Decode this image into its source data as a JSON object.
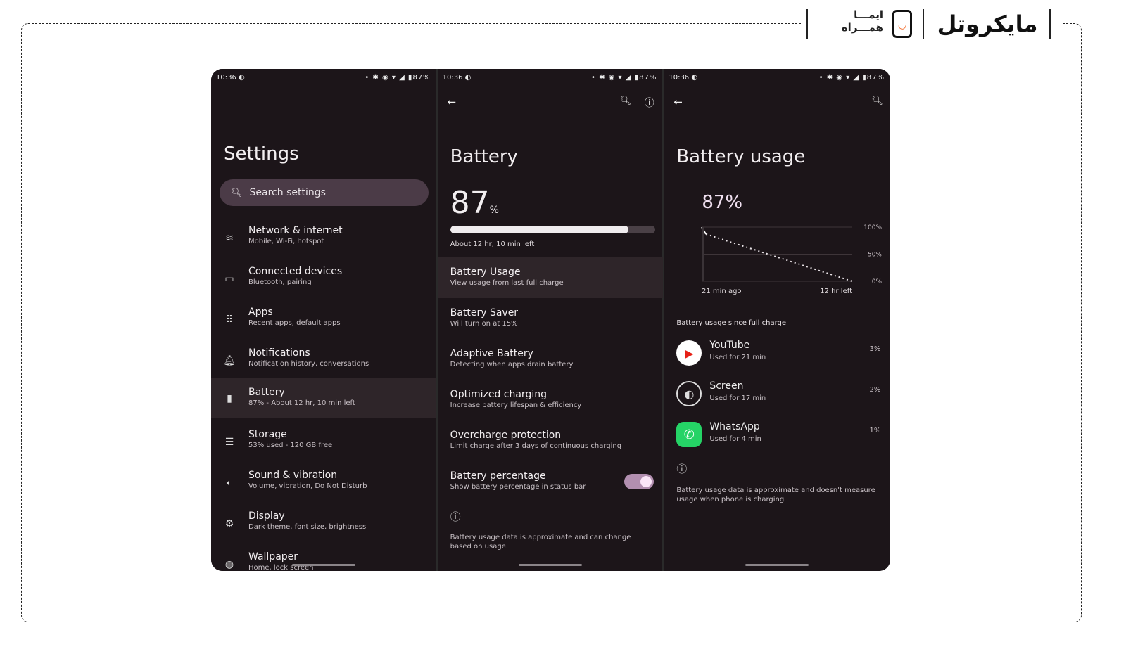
{
  "logo": {
    "brand": "مایکروتل",
    "partner_line1": "ایما",
    "partner_line2": "همراه"
  },
  "status_bar": {
    "time": "10:36",
    "battery": "87%"
  },
  "colors": {
    "background": "#1c1519",
    "highlight": "#2e2529",
    "search": "#4b3b47",
    "toggle": "#b28fb0",
    "whatsapp": "#25d366"
  },
  "settings": {
    "title": "Settings",
    "search_placeholder": "Search settings",
    "items": [
      {
        "icon": "wifi-icon",
        "title": "Network & internet",
        "subtitle": "Mobile, Wi-Fi, hotspot"
      },
      {
        "icon": "devices-icon",
        "title": "Connected devices",
        "subtitle": "Bluetooth, pairing"
      },
      {
        "icon": "apps-grid-icon",
        "title": "Apps",
        "subtitle": "Recent apps, default apps"
      },
      {
        "icon": "bell-icon",
        "title": "Notifications",
        "subtitle": "Notification history, conversations"
      },
      {
        "icon": "battery-icon",
        "title": "Battery",
        "subtitle": "87% - About 12 hr, 10 min left"
      },
      {
        "icon": "storage-icon",
        "title": "Storage",
        "subtitle": "53% used - 120 GB free"
      },
      {
        "icon": "speaker-icon",
        "title": "Sound & vibration",
        "subtitle": "Volume, vibration, Do Not Disturb"
      },
      {
        "icon": "display-icon",
        "title": "Display",
        "subtitle": "Dark theme, font size, brightness"
      },
      {
        "icon": "palette-icon",
        "title": "Wallpaper",
        "subtitle": "Home, lock screen"
      }
    ]
  },
  "battery": {
    "title": "Battery",
    "level": "87",
    "unit": "%",
    "level_fraction": 0.87,
    "time_left": "About 12 hr, 10 min left",
    "items": [
      {
        "title": "Battery Usage",
        "subtitle": "View usage from last full charge"
      },
      {
        "title": "Battery Saver",
        "subtitle": "Will turn on at 15%"
      },
      {
        "title": "Adaptive Battery",
        "subtitle": "Detecting when apps drain battery"
      },
      {
        "title": "Optimized charging",
        "subtitle": "Increase battery lifespan & efficiency"
      },
      {
        "title": "Overcharge protection",
        "subtitle": "Limit charge after 3 days of continuous charging"
      },
      {
        "title": "Battery percentage",
        "subtitle": "Show battery percentage in status bar",
        "toggle_on": true
      }
    ],
    "footer": "Battery usage data is approximate and can change based on usage."
  },
  "usage": {
    "title": "Battery usage",
    "level": "87%",
    "chart_data": {
      "type": "line",
      "y_ticks": [
        "100%",
        "50%",
        "0%"
      ],
      "x_labels": [
        "21 min ago",
        "12 hr left"
      ],
      "ylim": [
        0,
        100
      ],
      "series": [
        {
          "x": [
            0,
            1
          ],
          "y": [
            100,
            87
          ],
          "style": "solid"
        },
        {
          "x": [
            1,
            35
          ],
          "y": [
            87,
            0
          ],
          "style": "dotted"
        }
      ]
    },
    "section": "Battery usage since full charge",
    "apps": [
      {
        "name": "YouTube",
        "detail": "Used for 21 min",
        "percent": "3%"
      },
      {
        "name": "Screen",
        "detail": "Used for 17 min",
        "percent": "2%"
      },
      {
        "name": "WhatsApp",
        "detail": "Used for 4 min",
        "percent": "1%"
      }
    ],
    "footer": "Battery usage data is approximate and doesn't measure usage when phone is charging"
  }
}
